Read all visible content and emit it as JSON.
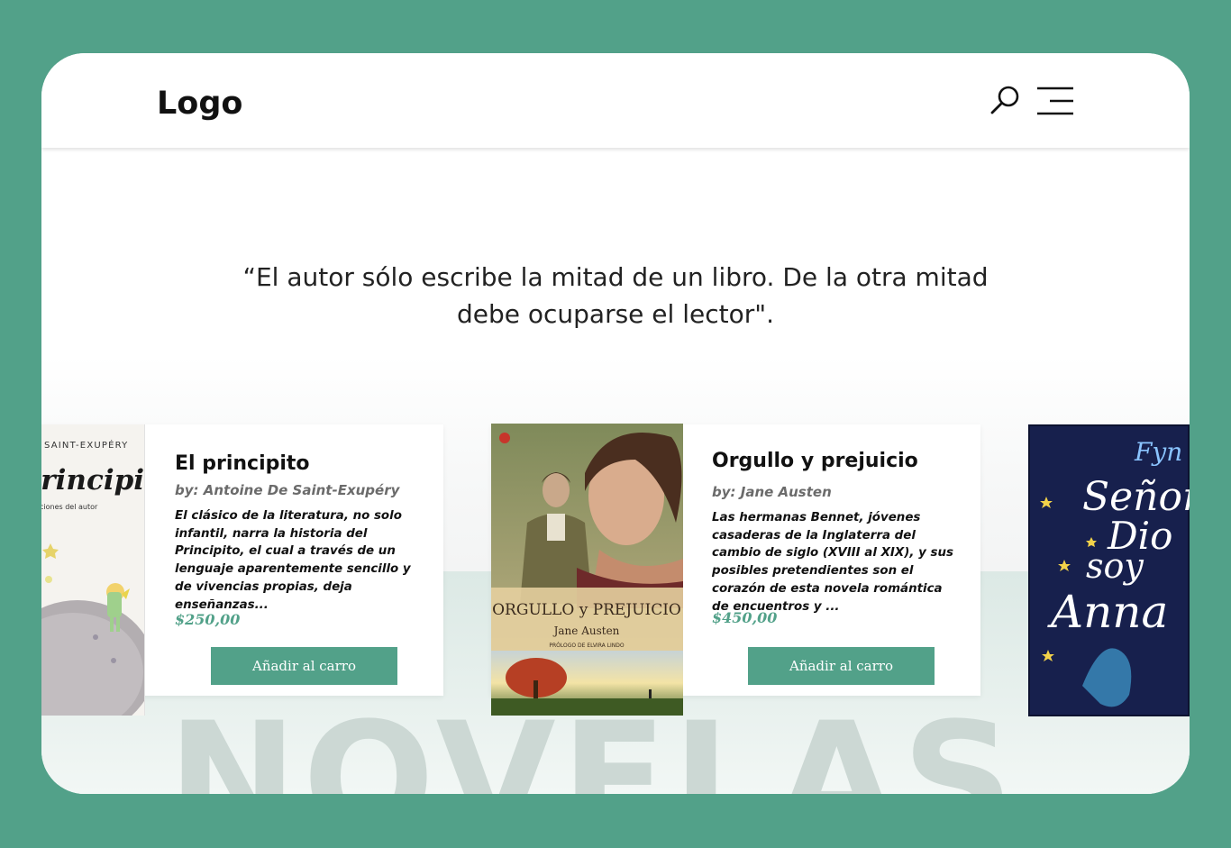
{
  "header": {
    "logo": "Logo",
    "icons": [
      "search-icon",
      "menu-icon"
    ]
  },
  "quote": {
    "text": "“El autor sólo escribe la mitad de un libro. De la otra mitad debe ocuparse el lector\"."
  },
  "section": {
    "watermark": "NOVELAS"
  },
  "books": [
    {
      "cover_author": "SAINT-EXUPÉRY",
      "cover_title": "Principito",
      "cover_subtitle": "ciones del autor",
      "title": "El principito",
      "author": "by: Antoine De Saint-Exupéry",
      "description": "El clásico de la literatura, no solo infantil, narra la historia del Principito, el cual a través de un lenguaje aparentemente sencillo y de vivencias propias, deja enseñanzas...",
      "price": "$250,00",
      "button": "Añadir al carro"
    },
    {
      "cover_title": "ORGULLO y PREJUICIO",
      "cover_author": "Jane Austen",
      "cover_prologue": "PRÓLOGO DE ELVIRA LINDO",
      "title": "Orgullo y prejuicio",
      "author": "by: Jane Austen",
      "description": "Las hermanas Bennet, jóvenes casaderas de la Inglaterra del cambio de siglo (XVIII al XIX), y sus posibles pretendientes son el corazón de esta novela romántica de encuentros y ...",
      "price": "$450,00",
      "button": "Añadir al carro"
    },
    {
      "cover_author": "Fyn",
      "cover_title_1": "Señor",
      "cover_title_2": "Dio",
      "cover_title_3": "soy",
      "cover_title_4": "Anna"
    }
  ],
  "colors": {
    "accent": "#52a189",
    "background": "#52a189",
    "text": "#111111"
  }
}
